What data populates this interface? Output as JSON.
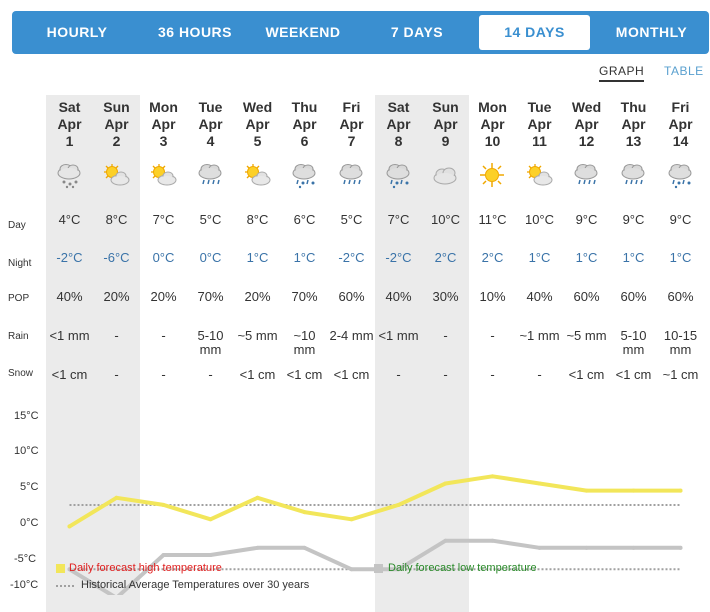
{
  "tabs": [
    {
      "label": "HOURLY",
      "active": false
    },
    {
      "label": "36 HOURS",
      "active": false
    },
    {
      "label": "WEEKEND",
      "active": false
    },
    {
      "label": "7 DAYS",
      "active": false
    },
    {
      "label": "14 DAYS",
      "active": true
    },
    {
      "label": "MONTHLY",
      "active": false
    }
  ],
  "view_toggle": {
    "graph": "GRAPH",
    "table": "TABLE",
    "active": "graph"
  },
  "row_labels": {
    "day": "Day",
    "night": "Night",
    "pop": "POP",
    "rain": "Rain",
    "snow": "Snow"
  },
  "days": [
    {
      "dow": "Sat",
      "month": "Apr",
      "date": "1",
      "icon": "snow-cloud-icon",
      "day": "4°C",
      "night": "-2°C",
      "pop": "40%",
      "rain": "<1 mm",
      "snow": "<1 cm",
      "weekend": true
    },
    {
      "dow": "Sun",
      "month": "Apr",
      "date": "2",
      "icon": "sun-cloud-icon",
      "day": "8°C",
      "night": "-6°C",
      "pop": "20%",
      "rain": "-",
      "snow": "-",
      "weekend": true
    },
    {
      "dow": "Mon",
      "month": "Apr",
      "date": "3",
      "icon": "sun-cloud-icon",
      "day": "7°C",
      "night": "0°C",
      "pop": "20%",
      "rain": "-",
      "snow": "-",
      "weekend": false
    },
    {
      "dow": "Tue",
      "month": "Apr",
      "date": "4",
      "icon": "rain-cloud-icon",
      "day": "5°C",
      "night": "0°C",
      "pop": "70%",
      "rain": "5-10 mm",
      "snow": "-",
      "weekend": false
    },
    {
      "dow": "Wed",
      "month": "Apr",
      "date": "5",
      "icon": "sun-cloud-icon",
      "day": "8°C",
      "night": "1°C",
      "pop": "20%",
      "rain": "~5 mm",
      "snow": "<1 cm",
      "weekend": false
    },
    {
      "dow": "Thu",
      "month": "Apr",
      "date": "6",
      "icon": "rain-snow-cloud-icon",
      "day": "6°C",
      "night": "1°C",
      "pop": "70%",
      "rain": "~10 mm",
      "snow": "<1 cm",
      "weekend": false
    },
    {
      "dow": "Fri",
      "month": "Apr",
      "date": "7",
      "icon": "rain-cloud-icon",
      "day": "5°C",
      "night": "-2°C",
      "pop": "60%",
      "rain": "2-4 mm",
      "snow": "<1 cm",
      "weekend": false
    },
    {
      "dow": "Sat",
      "month": "Apr",
      "date": "8",
      "icon": "rain-snow-cloud-icon",
      "day": "7°C",
      "night": "-2°C",
      "pop": "40%",
      "rain": "<1 mm",
      "snow": "-",
      "weekend": true
    },
    {
      "dow": "Sun",
      "month": "Apr",
      "date": "9",
      "icon": "cloud-icon",
      "day": "10°C",
      "night": "2°C",
      "pop": "30%",
      "rain": "-",
      "snow": "-",
      "weekend": true
    },
    {
      "dow": "Mon",
      "month": "Apr",
      "date": "10",
      "icon": "sun-icon",
      "day": "11°C",
      "night": "2°C",
      "pop": "10%",
      "rain": "-",
      "snow": "-",
      "weekend": false
    },
    {
      "dow": "Tue",
      "month": "Apr",
      "date": "11",
      "icon": "sun-cloud-icon",
      "day": "10°C",
      "night": "1°C",
      "pop": "40%",
      "rain": "~1 mm",
      "snow": "-",
      "weekend": false
    },
    {
      "dow": "Wed",
      "month": "Apr",
      "date": "12",
      "icon": "rain-cloud-icon",
      "day": "9°C",
      "night": "1°C",
      "pop": "60%",
      "rain": "~5 mm",
      "snow": "<1 cm",
      "weekend": false
    },
    {
      "dow": "Thu",
      "month": "Apr",
      "date": "13",
      "icon": "rain-cloud-icon",
      "day": "9°C",
      "night": "1°C",
      "pop": "60%",
      "rain": "5-10 mm",
      "snow": "<1 cm",
      "weekend": false
    },
    {
      "dow": "Fri",
      "month": "Apr",
      "date": "14",
      "icon": "rain-snow-cloud-icon",
      "day": "9°C",
      "night": "1°C",
      "pop": "60%",
      "rain": "10-15 mm",
      "snow": "~1 cm",
      "weekend": false
    }
  ],
  "colors": {
    "tab_bar": "#3a8fd0",
    "high_line": "#f2e65a",
    "low_line": "#c4c4c4",
    "avg_line": "#a0a0a0",
    "night_text": "#3a73a8",
    "weekend_shade": "#ebebeb",
    "legend_high_text": "#e02020",
    "legend_low_text": "#2a8a2a"
  },
  "chart_data": {
    "type": "line",
    "x": [
      "Sat Apr 1",
      "Sun Apr 2",
      "Mon Apr 3",
      "Tue Apr 4",
      "Wed Apr 5",
      "Thu Apr 6",
      "Fri Apr 7",
      "Sat Apr 8",
      "Sun Apr 9",
      "Mon Apr 10",
      "Tue Apr 11",
      "Wed Apr 12",
      "Thu Apr 13",
      "Fri Apr 14"
    ],
    "series": [
      {
        "name": "Daily forecast high temperature",
        "values": [
          4,
          8,
          7,
          5,
          8,
          6,
          5,
          7,
          10,
          11,
          10,
          9,
          9,
          9
        ]
      },
      {
        "name": "Daily forecast low temperature",
        "values": [
          -2,
          -6,
          0,
          0,
          1,
          1,
          -2,
          -2,
          2,
          2,
          1,
          1,
          1,
          1
        ]
      }
    ],
    "reference_lines": [
      {
        "name": "Historical Average Temperatures over 30 years",
        "values": [
          7,
          -2
        ]
      }
    ],
    "y_ticks": [
      "15°C",
      "10°C",
      "5°C",
      "0°C",
      "-5°C",
      "-10°C"
    ],
    "ylim": [
      -10,
      15
    ],
    "legend": [
      "Daily forecast high temperature",
      "Daily forecast low temperature",
      "Historical Average Temperatures over 30 years"
    ],
    "legend_position": "bottom-left",
    "grid": false
  }
}
